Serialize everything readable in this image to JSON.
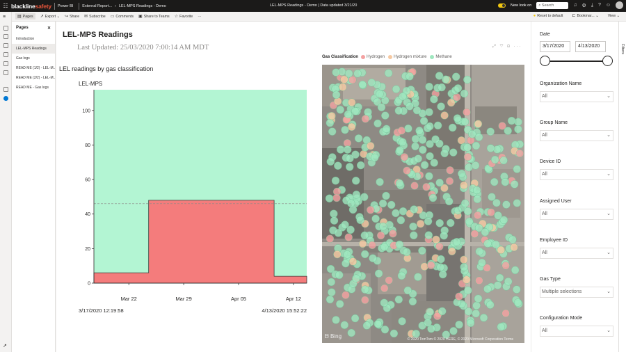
{
  "topbar": {
    "logo_a": "blackline",
    "logo_b": "safety",
    "product": "Power BI",
    "crumb_1": "External Report...",
    "crumb_2": "LEL-MPS Readings - Demo",
    "center_title": "LEL-MPS Readings - Demo  |  Data updated 3/21/20",
    "new_look": "New look on",
    "search_placeholder": "Search"
  },
  "actionbar": {
    "pages": "Pages",
    "export": "Export",
    "share": "Share",
    "subscribe": "Subscribe",
    "comments": "Comments",
    "share_teams": "Share to Teams",
    "favorite": "Favorite",
    "more": "···",
    "reset": "Reset to default",
    "bookmarks": "Bookmar...",
    "view": "View"
  },
  "pages_pane": {
    "title": "Pages",
    "items": [
      "Introduction",
      "LEL-MPS Readings",
      "Gas logs",
      "READ ME (1/2) - LEL-M...",
      "READ ME (2/2) - LEL-M...",
      "READ ME - Gas logs"
    ],
    "selected_index": 1
  },
  "report": {
    "title": "LEL-MPS Readings",
    "last_updated": "Last Updated: 25/03/2020 7:00:14 AM MDT",
    "chart_title": "LEL readings by gas classification"
  },
  "chart_data": {
    "type": "area",
    "ylabel": "LEL-MPS",
    "ylim": [
      0,
      112
    ],
    "yticks": [
      0,
      20,
      40,
      60,
      80,
      100
    ],
    "xticks": [
      "Mar 22",
      "Mar 29",
      "Apr 05",
      "Apr 12"
    ],
    "xstart_label": "3/17/2020 12:19:58",
    "xend_label": "4/13/2020 15:52:22",
    "reference_line": 46,
    "series": [
      {
        "name": "Hydrogen",
        "color": "#f47c7c",
        "points": [
          [
            "2020-03-17",
            6
          ],
          [
            "2020-03-24",
            6
          ],
          [
            "2020-03-24",
            48
          ],
          [
            "2020-04-09",
            48
          ],
          [
            "2020-04-09",
            4
          ],
          [
            "2020-04-13",
            4
          ]
        ]
      },
      {
        "name": "Methane",
        "color": "#b3f5d3",
        "points": [
          [
            "2020-03-17",
            112
          ],
          [
            "2020-04-13",
            112
          ]
        ]
      }
    ]
  },
  "map": {
    "legend_title": "Gas Classification",
    "legend": [
      {
        "label": "Hydrogen",
        "color": "#f4a1a1"
      },
      {
        "label": "Hydrogen mixture",
        "color": "#f6c9a2"
      },
      {
        "label": "Methane",
        "color": "#9fe7bf"
      }
    ],
    "attribution": "© 2020 TomTom © 2020 HERE, © 2020 Microsoft Corporation Terms",
    "bing": "Bing"
  },
  "filters": {
    "date_label": "Date",
    "date_from": "3/17/2020",
    "date_to": "4/13/2020",
    "slider_range": [
      0,
      1
    ],
    "items": [
      {
        "label": "Organization Name",
        "value": "All"
      },
      {
        "label": "Group Name",
        "value": "All"
      },
      {
        "label": "Device ID",
        "value": "All"
      },
      {
        "label": "Assigned User",
        "value": "All"
      },
      {
        "label": "Employee ID",
        "value": "All"
      },
      {
        "label": "Gas Type",
        "value": "Multiple selections"
      },
      {
        "label": "Configuration Mode",
        "value": "All"
      }
    ],
    "rail_label": "Filters"
  }
}
